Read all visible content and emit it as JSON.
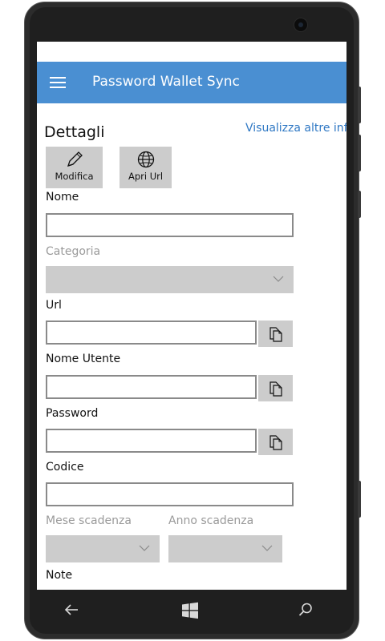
{
  "app": {
    "title": "Password Wallet Sync"
  },
  "details": {
    "title": "Dettagli",
    "more_info_link": "Visualizza altre inf",
    "buttons": [
      {
        "label": "Modifica",
        "icon": "pencil-icon"
      },
      {
        "label": "Apri Url",
        "icon": "globe-icon"
      }
    ]
  },
  "fields": {
    "name": {
      "label": "Nome",
      "value": ""
    },
    "category": {
      "label": "Categoria",
      "value": ""
    },
    "url": {
      "label": "Url",
      "value": ""
    },
    "username": {
      "label": "Nome Utente",
      "value": ""
    },
    "password": {
      "label": "Password",
      "value": ""
    },
    "code": {
      "label": "Codice",
      "value": ""
    },
    "expiry_month": {
      "label": "Mese scadenza",
      "value": ""
    },
    "expiry_year": {
      "label": "Anno scadenza",
      "value": ""
    },
    "note": {
      "label": "Note"
    }
  },
  "navbar": {
    "back": "back-arrow-icon",
    "start": "windows-start-icon",
    "search": "search-icon"
  },
  "colors": {
    "appbar": "#4a8fd2",
    "link": "#2f78c4",
    "control_fill": "#cccccc"
  }
}
